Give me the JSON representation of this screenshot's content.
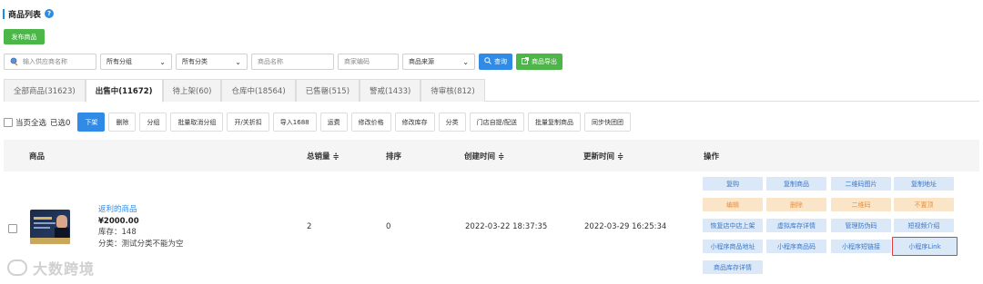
{
  "header": {
    "title": "商品列表",
    "help_icon": "question-circle-icon"
  },
  "publish_button": "发布商品",
  "filters": {
    "supplier_placeholder": "输入供应商名称",
    "group_select": "所有分组",
    "category_select": "所有分类",
    "product_name_placeholder": "商品名称",
    "product_code_placeholder": "商家编码",
    "source_select": "商品来源",
    "query_button": "查询",
    "export_button": "商品导出"
  },
  "tabs": [
    {
      "label": "全部商品(31623)"
    },
    {
      "label": "出售中(11672)"
    },
    {
      "label": "待上架(60)"
    },
    {
      "label": "仓库中(18564)"
    },
    {
      "label": "已售罄(515)"
    },
    {
      "label": "警戒(1433)"
    },
    {
      "label": "待审核(812)"
    }
  ],
  "bulk_actions": {
    "select_all": "当页全选",
    "selected": "已选0",
    "buttons": [
      "下架",
      "删除",
      "分组",
      "批量取消分组",
      "开/关折扣",
      "导入1688",
      "运费",
      "修改价格",
      "修改库存",
      "分类",
      "门店自提/配送",
      "批量复制商品",
      "同步快团团"
    ]
  },
  "table": {
    "headers": {
      "product": "商品",
      "total_sales": "总销量 ≑",
      "sort": "排序",
      "created": "创建时间 ≑",
      "updated": "更新时间 ≑",
      "actions": "操作"
    },
    "rows": [
      {
        "name": "返利的商品",
        "price": "¥2000.00",
        "stock": "库存：148",
        "category": "分类：测试分类不能为空",
        "total_sales": "2",
        "sort": "0",
        "created": "2022-03-22 18:37:35",
        "updated": "2022-03-29 16:25:34",
        "operations": [
          "复购",
          "复制商品",
          "二维码图片",
          "复制地址",
          "编辑",
          "删除",
          "二维码",
          "不置顶",
          "恢复店中店上架",
          "虚拟库存详情",
          "管理防伪码",
          "短视频介绍",
          "小程序商品地址",
          "小程序商品码",
          "小程序短链接",
          "小程序Link",
          "商品库存详情"
        ]
      }
    ]
  },
  "watermark": "大数跨境",
  "colors": {
    "primary": "#2f8be6",
    "success": "#4cb648",
    "warning_bg": "#fbe5c9",
    "highlight": "#e23b3b"
  }
}
